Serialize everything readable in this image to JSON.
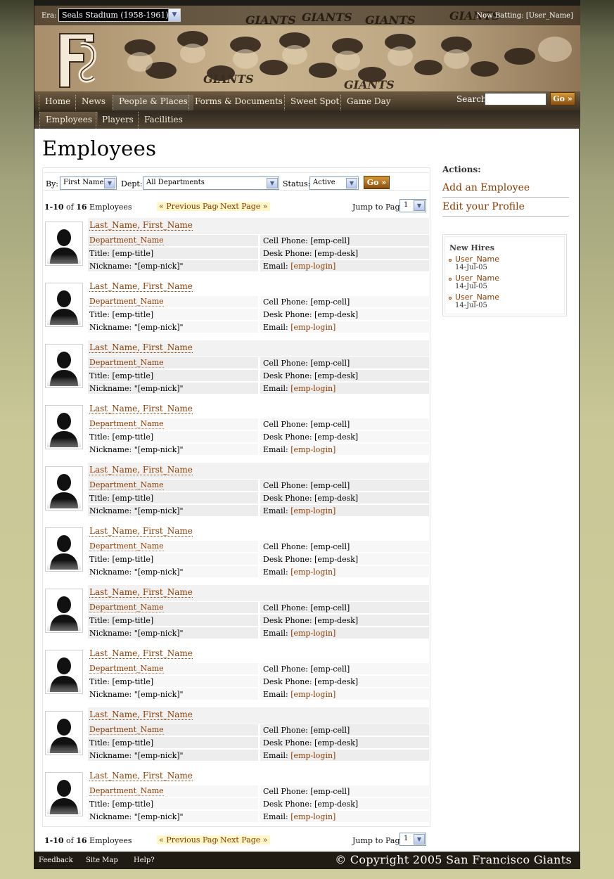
{
  "header": {
    "era_label": "Era:",
    "era_value": "Seals Stadium (1958-1961)",
    "now_batting": "Now Batting: [User_Name]",
    "search_label": "Search:",
    "search_button": "Go »"
  },
  "nav": {
    "items": [
      {
        "label": "Home"
      },
      {
        "label": "News"
      },
      {
        "label": "People & Places",
        "active": true
      },
      {
        "label": "Forms & Documents"
      },
      {
        "label": "Sweet Spot"
      },
      {
        "label": "Game Day"
      }
    ]
  },
  "subnav": {
    "items": [
      {
        "label": "Employees",
        "active": true
      },
      {
        "label": "Players"
      },
      {
        "label": "Facilities"
      }
    ]
  },
  "page": {
    "title": "Employees"
  },
  "filters": {
    "by_label": "By:",
    "by_value": "First Name",
    "dept_label": "Dept:",
    "dept_value": "All Departments",
    "status_label": "Status:",
    "status_value": "Active",
    "go_button": "Go »"
  },
  "pager": {
    "range": "1-10",
    "of": "of",
    "total": "16",
    "unit": "Employees",
    "prev": "« Previous Page",
    "next": "Next Page »",
    "jump_label": "Jump to Page:",
    "jump_value": "1"
  },
  "employee_template": {
    "name": "Last_Name, First_Name",
    "department": "Department_Name",
    "title": "Title: [emp-title]",
    "nickname": "Nickname: \"[emp-nick]\"",
    "cell": "Cell Phone: [emp-cell]",
    "desk": "Desk Phone: [emp-desk]",
    "email_label": "Email:",
    "email_value": "[emp-login]"
  },
  "employees_count": 10,
  "sidebar": {
    "actions_title": "Actions:",
    "actions": [
      "Add an Employee",
      "Edit your Profile"
    ],
    "new_hires_title": "New Hires",
    "new_hires": [
      {
        "user": "User_Name",
        "date": "14-Jul-05"
      },
      {
        "user": "User_Name",
        "date": "14-Jul-05"
      },
      {
        "user": "User_Name",
        "date": "14-Jul-05"
      }
    ]
  },
  "footer": {
    "links": [
      "Feedback",
      "Site Map",
      "Help?"
    ],
    "copyright": "© Copyright 2005 San Francisco Giants"
  },
  "colors": {
    "link": "#8a3b00",
    "nav_dark": "#211c13",
    "accent_button": "#b46d1d"
  }
}
